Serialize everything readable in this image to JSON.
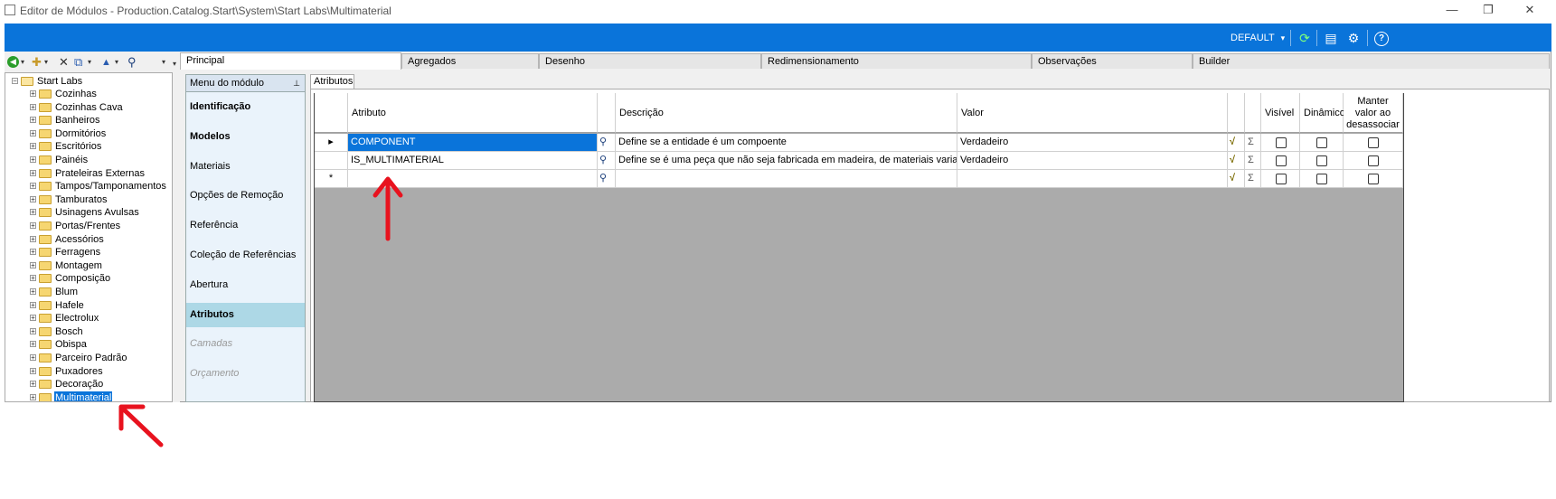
{
  "window": {
    "title": "Editor de Módulos - Production.Catalog.Start\\System\\Start Labs\\Multimaterial",
    "controls": {
      "minimize": "—",
      "restore": "❐",
      "close": "✕"
    }
  },
  "toolbar": {
    "profile": "DEFAULT",
    "profile_caret": "▾",
    "icons": {
      "refresh": "⟳",
      "layout": "▤",
      "settings": "⚙",
      "help": "?"
    }
  },
  "left_toolbar": {
    "glyphs": [
      "●",
      "▾",
      "✚",
      "▾",
      "✕",
      "⧉",
      "▾",
      "▲",
      "▾",
      "⚲",
      "▾"
    ]
  },
  "tree": {
    "root": "Start Labs",
    "items": [
      {
        "label": "Cozinhas"
      },
      {
        "label": "Cozinhas Cava"
      },
      {
        "label": "Banheiros"
      },
      {
        "label": "Dormitórios"
      },
      {
        "label": "Escritórios"
      },
      {
        "label": "Painéis"
      },
      {
        "label": "Prateleiras Externas"
      },
      {
        "label": "Tampos/Tamponamentos"
      },
      {
        "label": "Tamburatos"
      },
      {
        "label": "Usinagens Avulsas"
      },
      {
        "label": "Portas/Frentes"
      },
      {
        "label": "Acessórios"
      },
      {
        "label": "Ferragens"
      },
      {
        "label": "Montagem"
      },
      {
        "label": "Composição"
      },
      {
        "label": "Blum"
      },
      {
        "label": "Hafele"
      },
      {
        "label": "Electrolux"
      },
      {
        "label": "Bosch"
      },
      {
        "label": "Obispa"
      },
      {
        "label": "Parceiro Padrão"
      },
      {
        "label": "Puxadores"
      },
      {
        "label": "Decoração"
      },
      {
        "label": "Multimaterial",
        "selected": true
      }
    ]
  },
  "tabs": [
    {
      "label": "Principal",
      "active": true
    },
    {
      "label": "Agregados"
    },
    {
      "label": "Desenho"
    },
    {
      "label": "Redimensionamento"
    },
    {
      "label": "Observações"
    },
    {
      "label": "Builder"
    }
  ],
  "menu": {
    "header": "Menu do módulo",
    "pin": "⊥",
    "items": [
      {
        "label": "Identificação",
        "style": "bold"
      },
      {
        "label": "Modelos",
        "style": "bold"
      },
      {
        "label": "Materiais",
        "style": "normal"
      },
      {
        "label": "Opções de Remoção",
        "style": "normal"
      },
      {
        "label": "Referência",
        "style": "normal"
      },
      {
        "label": "Coleção de Referências",
        "style": "normal"
      },
      {
        "label": "Abertura",
        "style": "normal"
      },
      {
        "label": "Atributos",
        "style": "bold-active"
      },
      {
        "label": "Camadas",
        "style": "disabled"
      },
      {
        "label": "Orçamento",
        "style": "disabled"
      }
    ]
  },
  "subtab": {
    "label": "Atributos"
  },
  "grid": {
    "columns": {
      "atributo": "Atributo",
      "descricao": "Descrição",
      "valor": "Valor",
      "visivel": "Visível",
      "dinamico": "Dinâmico",
      "manter": "Manter valor ao desassociar"
    },
    "rows": [
      {
        "indicator": "▸",
        "atributo": "COMPONENT",
        "descricao": "Define se a entidade é um compoente",
        "valor": "Verdadeiro",
        "selected": true
      },
      {
        "indicator": "",
        "atributo": "IS_MULTIMATERIAL",
        "descricao": "Define se é uma peça que não seja fabricada em madeira, de materiais variados que...",
        "valor": "Verdadeiro"
      },
      {
        "indicator": "*",
        "atributo": "",
        "descricao": "",
        "valor": ""
      }
    ],
    "cell_glyphs": {
      "lookup": "⚲",
      "formula": "√",
      "sigma": "Σ"
    }
  },
  "annotations": {
    "accent": "#e8121e"
  }
}
